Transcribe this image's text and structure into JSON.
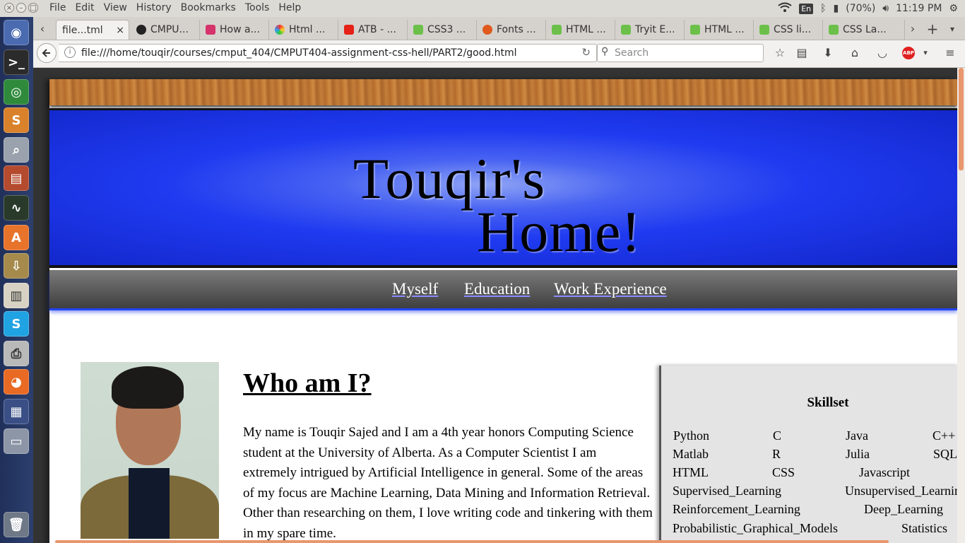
{
  "menubar": {
    "menus": [
      "File",
      "Edit",
      "View",
      "History",
      "Bookmarks",
      "Tools",
      "Help"
    ],
    "lang": "En",
    "battery": "(70%)",
    "time": "11:19 PM"
  },
  "tabs": [
    {
      "label": "file...tml",
      "active": true,
      "favicon_color": "#ffffff"
    },
    {
      "label": "CMPU...",
      "favicon_color": "#222222"
    },
    {
      "label": "How a...",
      "favicon_color": "#d6336c"
    },
    {
      "label": "Html ...",
      "favicon_color": "#3b7ddd"
    },
    {
      "label": "ATB - ...",
      "favicon_color": "#e62117"
    },
    {
      "label": "CSS3 ...",
      "favicon_color": "#6cc04a"
    },
    {
      "label": "Fonts ...",
      "favicon_color": "#e05a1e"
    },
    {
      "label": "HTML ...",
      "favicon_color": "#6cc04a"
    },
    {
      "label": "Tryit E...",
      "favicon_color": "#6cc04a"
    },
    {
      "label": "HTML ...",
      "favicon_color": "#6cc04a"
    },
    {
      "label": "CSS li...",
      "favicon_color": "#6cc04a"
    },
    {
      "label": "CSS La...",
      "favicon_color": "#6cc04a"
    }
  ],
  "navbar": {
    "url": "file:///home/touqir/courses/cmput_404/CMPUT404-assignment-css-hell/PART2/good.html",
    "search_placeholder": "Search"
  },
  "page": {
    "banner_line1": "Touqir's",
    "banner_line2": "Home!",
    "nav": [
      "Myself",
      "Education",
      "Work Experience"
    ],
    "heading": "Who am I?",
    "paragraph": "My name is Touqir Sajed and I am a 4th year honors Computing Science student at the University of Alberta. As a Computer Scientist I am extremely intrigued by Artificial Intelligence in general. Some of the areas of my focus are Machine Learning, Data Mining and Information Retrieval. Other than researching on them, I love writing code and tinkering with them in my spare time.",
    "skillset_title": "Skillset",
    "skills": [
      "Python",
      "C",
      "Java",
      "C++",
      "Matlab",
      "R",
      "Julia",
      "SQL",
      "HTML",
      "CSS",
      "Javascript",
      "Supervised_Learning",
      "Unsupervised_Learning",
      "Reinforcement_Learning",
      "Deep_Learning",
      "Probabilistic_Graphical_Models",
      "Statistics"
    ]
  },
  "colors": {
    "banner_blue": "#1f3af0",
    "nav_underline": "#2244ee",
    "scroll_accent": "#e8976f"
  }
}
